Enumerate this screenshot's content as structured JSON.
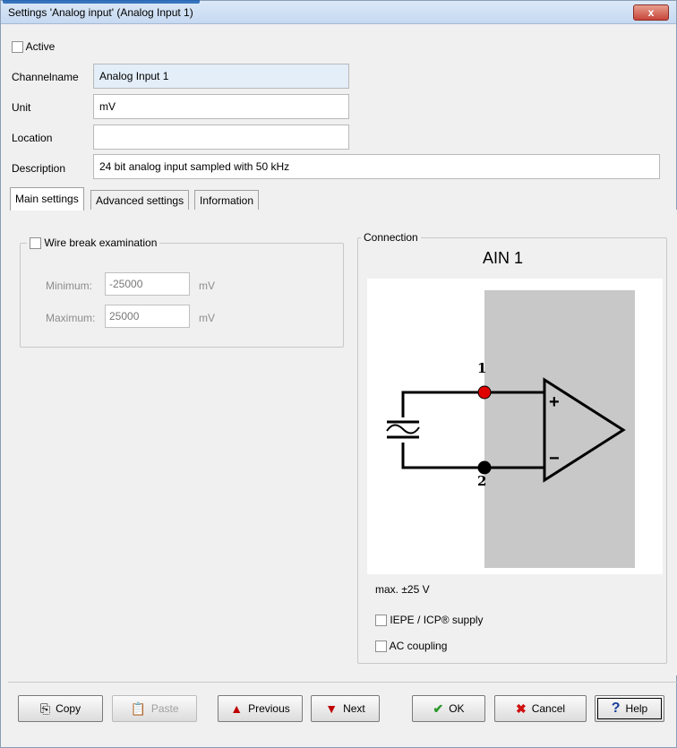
{
  "window": {
    "title": "Settings 'Analog input' (Analog Input 1)",
    "close_label": "x"
  },
  "general": {
    "active_label": "Active",
    "active_checked": false,
    "channelname_label": "Channelname",
    "channelname_value": "Analog Input 1",
    "unit_label": "Unit",
    "unit_value": "mV",
    "location_label": "Location",
    "location_value": "",
    "description_label": "Description",
    "description_value": "24 bit analog input sampled with 50 kHz"
  },
  "tabs": [
    {
      "label": "Main settings",
      "active": true
    },
    {
      "label": "Advanced settings",
      "active": false
    },
    {
      "label": "Information",
      "active": false
    }
  ],
  "wire_break": {
    "label": "Wire break examination",
    "checked": false,
    "minimum_label": "Minimum:",
    "minimum_value": "-25000",
    "minimum_unit": "mV",
    "maximum_label": "Maximum:",
    "maximum_value": "25000",
    "maximum_unit": "mV"
  },
  "connection": {
    "caption": "Connection",
    "channel_title": "AIN 1",
    "pin1": "1",
    "pin2": "2",
    "plus": "+",
    "minus": "−",
    "range_note": "max. ±25 V",
    "iepe_label": "IEPE / ICP® supply",
    "ac_label": "AC coupling"
  },
  "buttons": {
    "copy": "Copy",
    "paste": "Paste",
    "previous": "Previous",
    "next": "Next",
    "ok": "OK",
    "cancel": "Cancel",
    "help": "Help"
  },
  "colors": {
    "pin1": "#e00000",
    "pin2": "#000000",
    "amp_bg": "#c8c8c8",
    "ok_check": "#2a9a2a",
    "cancel_x": "#d01010",
    "arrow": "#c00000",
    "help": "#1a3c9c"
  }
}
